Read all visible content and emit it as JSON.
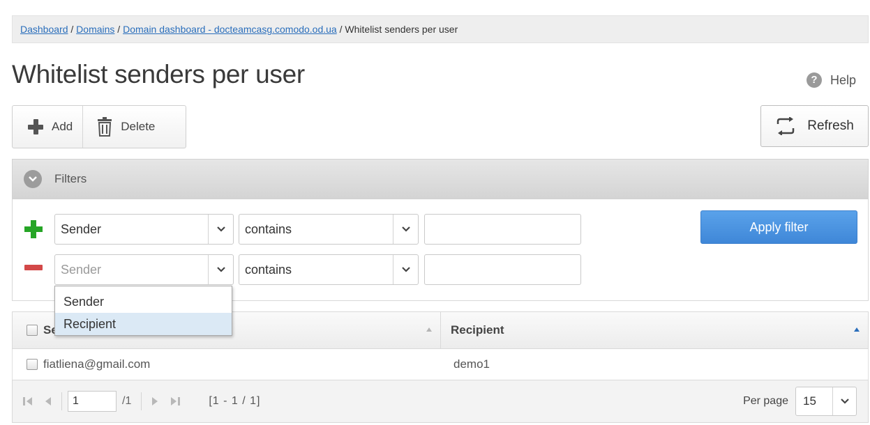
{
  "breadcrumb": {
    "items": [
      {
        "label": "Dashboard",
        "link": true
      },
      {
        "label": "Domains",
        "link": true
      },
      {
        "label": "Domain dashboard - docteamcasg.comodo.od.ua",
        "link": true
      },
      {
        "label": "Whitelist senders per user",
        "link": false
      }
    ],
    "separator": " / "
  },
  "page": {
    "title": "Whitelist senders per user",
    "help_label": "Help",
    "help_icon": "question-circle-icon"
  },
  "toolbar": {
    "add_label": "Add",
    "delete_label": "Delete",
    "refresh_label": "Refresh"
  },
  "filters": {
    "title": "Filters",
    "apply_label": "Apply filter",
    "rows": [
      {
        "field": "Sender",
        "field_placeholder": false,
        "operator": "contains",
        "value": ""
      },
      {
        "field": "Sender",
        "field_placeholder": true,
        "operator": "contains",
        "value": ""
      }
    ],
    "field_dropdown": {
      "options": [
        "Sender",
        "Recipient"
      ],
      "highlighted": "Recipient"
    }
  },
  "table": {
    "columns": [
      "Sender",
      "Recipient"
    ],
    "rows": [
      {
        "sender": "fiatliena@gmail.com",
        "recipient": "demo1"
      }
    ]
  },
  "pager": {
    "page_value": "1",
    "of_pages": "/1",
    "range": "[1 - 1 / 1]",
    "per_page_label": "Per page",
    "per_page_value": "15"
  },
  "colors": {
    "link": "#2a6ebb",
    "apply": "#4a93e0",
    "add_row": "#26a526",
    "remove_row": "#d34848"
  }
}
